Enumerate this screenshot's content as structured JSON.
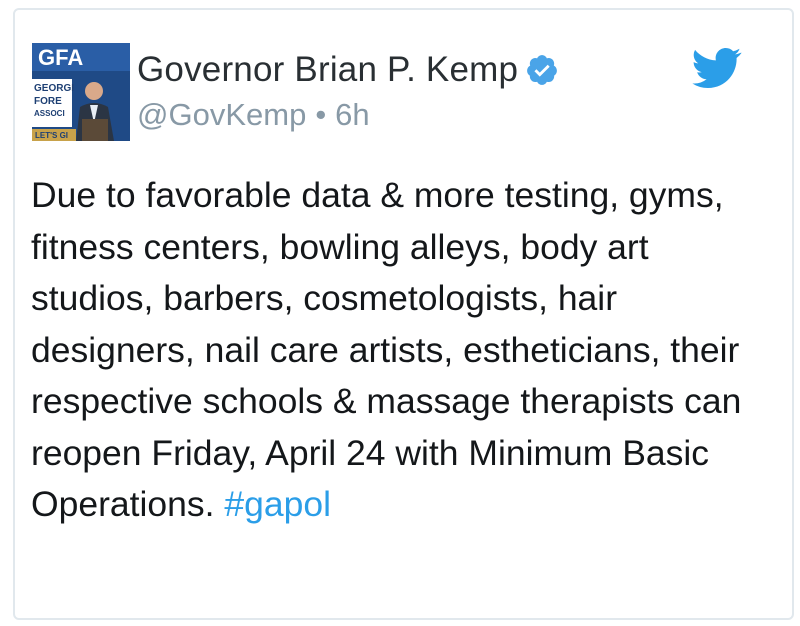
{
  "tweet": {
    "author": {
      "display_name": "Governor Brian P. Kemp",
      "handle": "@GovKemp",
      "separator": "•",
      "time_ago": "6h",
      "verified": true,
      "avatar": {
        "logo_text": "GFA",
        "banner_line1": "GEORGI",
        "banner_line2": "FORE",
        "banner_line3": "ASSOCI",
        "banner_bottom": "LET'S GI"
      }
    },
    "text": "Due to favorable data & more testing, gyms, fitness centers, bowling alleys, body art studios, barbers, cosmetologists, hair designers, nail care artists, estheticians, their respective schools & massage therapists can reopen Friday, April 24 with Minimum Basic Operations.",
    "hashtag": "#gapol",
    "icons": {
      "brand": "twitter-bird-icon",
      "verified": "verified-badge-icon"
    },
    "colors": {
      "text": "#14171a",
      "secondary": "#8899a6",
      "accent": "#2b9ee8",
      "verified": "#4aa4e8"
    }
  }
}
